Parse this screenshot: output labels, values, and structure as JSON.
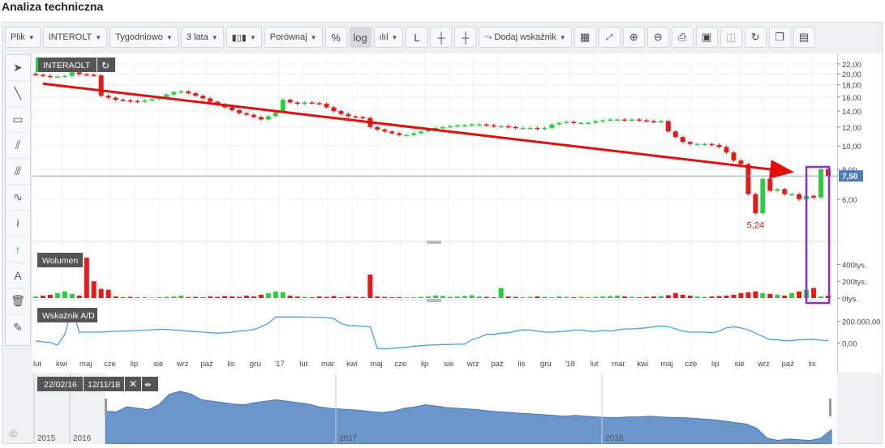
{
  "page": {
    "title": "Analiza techniczna"
  },
  "toolbar": {
    "file": "Plik",
    "symbol": "INTEROLT",
    "interval": "Tygodniowo",
    "range": "3 lata",
    "compare": "Porównaj",
    "percent": "%",
    "log": "log",
    "l": "L",
    "add_indicator": "Dodaj wskaźnik"
  },
  "left_tools": [
    "cursor-icon",
    "line-icon",
    "rectangle-icon",
    "fan-icon",
    "parallel-lines-icon",
    "wave-icon",
    "wave2-icon",
    "arrow-up-icon",
    "text-icon",
    "trash-icon",
    "ruler-icon"
  ],
  "panels": {
    "price_label": "INTERAOLT",
    "volume_label": "Wolumen",
    "ad_label": "Wskaźnik A/D"
  },
  "navigator": {
    "from": "22/02/16",
    "to": "12/11/18",
    "years": [
      "2015",
      "2016",
      "2017",
      "2018"
    ]
  },
  "colors": {
    "up": "#2ecc40",
    "down": "#e31b1b",
    "ad_line": "#4a9fe0",
    "nav_fill": "#6b96cc",
    "price_tag": "#4a7bbd",
    "trend": "#e01010",
    "highlight": "#8a2be2"
  },
  "chart_data": {
    "type": "candlestick",
    "x_ticks": [
      "lut",
      "kwi",
      "maj",
      "cze",
      "lip",
      "sie",
      "wrz",
      "paź",
      "lis",
      "gru",
      "'17",
      "lut",
      "mar",
      "kwi",
      "maj",
      "cze",
      "lip",
      "sie",
      "wrz",
      "paź",
      "lis",
      "gru",
      "'18",
      "lut",
      "mar",
      "kwi",
      "maj",
      "cze",
      "lip",
      "sie",
      "wrz",
      "paź",
      "lis"
    ],
    "price": {
      "y_ticks": [
        "22,00",
        "20,00",
        "18,00",
        "16,00",
        "14,00",
        "12,00",
        "10,00",
        "8,00",
        "6,00"
      ],
      "ylim": [
        4,
        22.5
      ],
      "last_price": "7,50",
      "min_label": "5,24",
      "close": [
        19.8,
        19.6,
        19.4,
        19.5,
        19.6,
        20.3,
        19.9,
        19.8,
        19.7,
        16.2,
        15.9,
        15.6,
        15.5,
        15.4,
        15.3,
        15.5,
        15.7,
        16.0,
        16.4,
        16.8,
        16.9,
        16.6,
        16.2,
        15.8,
        15.3,
        14.9,
        14.5,
        14.1,
        13.7,
        13.5,
        13.2,
        12.9,
        13.3,
        13.8,
        15.6,
        15.2,
        15.0,
        15.2,
        15.1,
        15.0,
        14.5,
        14.0,
        13.6,
        13.3,
        13.2,
        13.1,
        12.0,
        11.7,
        11.5,
        11.3,
        11.1,
        11.1,
        11.3,
        11.5,
        11.7,
        11.9,
        12.0,
        12.1,
        12.2,
        12.2,
        12.3,
        12.3,
        12.2,
        12.1,
        12.1,
        12.0,
        11.9,
        11.9,
        11.9,
        11.8,
        11.9,
        12.3,
        12.5,
        12.6,
        12.5,
        12.5,
        12.5,
        12.7,
        12.8,
        12.9,
        12.9,
        12.8,
        12.9,
        12.8,
        12.7,
        12.6,
        12.7,
        11.5,
        10.9,
        10.4,
        10.2,
        10.2,
        10.2,
        10.1,
        9.9,
        9.4,
        8.7,
        8.4,
        6.3,
        5.24,
        7.3,
        6.5,
        6.6,
        6.3,
        6.3,
        6.0,
        6.2,
        6.1,
        8.0,
        7.5
      ],
      "trend_from": [
        1,
        18.2
      ],
      "trend_to": [
        104,
        7.8
      ]
    },
    "volume": {
      "y_ticks": [
        "400tys.",
        "200tys.",
        "0tys."
      ],
      "ylim": [
        0,
        500
      ],
      "values": [
        20,
        30,
        40,
        60,
        80,
        50,
        30,
        480,
        200,
        110,
        100,
        20,
        10,
        15,
        8,
        12,
        6,
        10,
        15,
        20,
        30,
        12,
        15,
        10,
        20,
        15,
        25,
        20,
        15,
        30,
        20,
        40,
        60,
        80,
        70,
        30,
        20,
        15,
        10,
        20,
        15,
        25,
        10,
        20,
        15,
        12,
        280,
        20,
        15,
        10,
        12,
        8,
        10,
        15,
        20,
        30,
        25,
        15,
        20,
        25,
        35,
        20,
        15,
        10,
        120,
        20,
        15,
        10,
        15,
        20,
        15,
        10,
        20,
        15,
        10,
        15,
        12,
        15,
        20,
        25,
        30,
        20,
        15,
        10,
        15,
        20,
        25,
        35,
        60,
        40,
        30,
        20,
        15,
        20,
        25,
        30,
        40,
        60,
        70,
        80,
        60,
        50,
        40,
        30,
        60,
        80,
        100,
        120,
        20,
        30,
        60
      ]
    },
    "ad": {
      "y_ticks": [
        "200.000,00",
        "0,00"
      ],
      "ylim": [
        -80000,
        340000
      ],
      "values": [
        20000,
        10000,
        5000,
        -20000,
        80000,
        320000,
        100000,
        100000,
        100000,
        100000,
        105000,
        108000,
        110000,
        112000,
        115000,
        118000,
        122000,
        126000,
        125000,
        120000,
        115000,
        110000,
        105000,
        100000,
        95000,
        90000,
        95000,
        100000,
        110000,
        115000,
        125000,
        150000,
        180000,
        240000,
        240000,
        240000,
        240000,
        240000,
        238000,
        238000,
        235000,
        225000,
        180000,
        160000,
        160000,
        155000,
        150000,
        -50000,
        -55000,
        -50000,
        -45000,
        -40000,
        -30000,
        -25000,
        -20000,
        -18000,
        -15000,
        -15000,
        -12000,
        -10000,
        30000,
        50000,
        80000,
        80000,
        90000,
        95000,
        110000,
        120000,
        120000,
        110000,
        100000,
        100000,
        105000,
        110000,
        118000,
        120000,
        110000,
        105000,
        118000,
        110000,
        120000,
        130000,
        130000,
        135000,
        140000,
        150000,
        158000,
        150000,
        130000,
        110000,
        100000,
        100000,
        100000,
        95000,
        110000,
        140000,
        150000,
        140000,
        120000,
        90000,
        60000,
        30000,
        30000,
        20000,
        20000,
        30000,
        30000,
        35000,
        25000,
        20000,
        10000
      ]
    },
    "navigator_values": [
      0.46,
      0.45,
      0.52,
      0.5,
      0.48,
      0.55,
      0.7,
      0.74,
      0.7,
      0.62,
      0.6,
      0.58,
      0.56,
      0.55,
      0.58,
      0.6,
      0.62,
      0.6,
      0.58,
      0.56,
      0.52,
      0.5,
      0.49,
      0.48,
      0.47,
      0.45,
      0.44,
      0.46,
      0.5,
      0.52,
      0.55,
      0.53,
      0.51,
      0.5,
      0.49,
      0.48,
      0.46,
      0.45,
      0.44,
      0.43,
      0.42,
      0.41,
      0.4,
      0.39,
      0.4,
      0.39,
      0.38,
      0.37,
      0.37,
      0.38,
      0.38,
      0.39,
      0.38,
      0.37,
      0.37,
      0.36,
      0.35,
      0.34,
      0.32,
      0.3,
      0.28,
      0.22,
      0.08,
      0.05,
      0.07,
      0.06,
      0.05,
      0.08,
      0.2
    ]
  }
}
